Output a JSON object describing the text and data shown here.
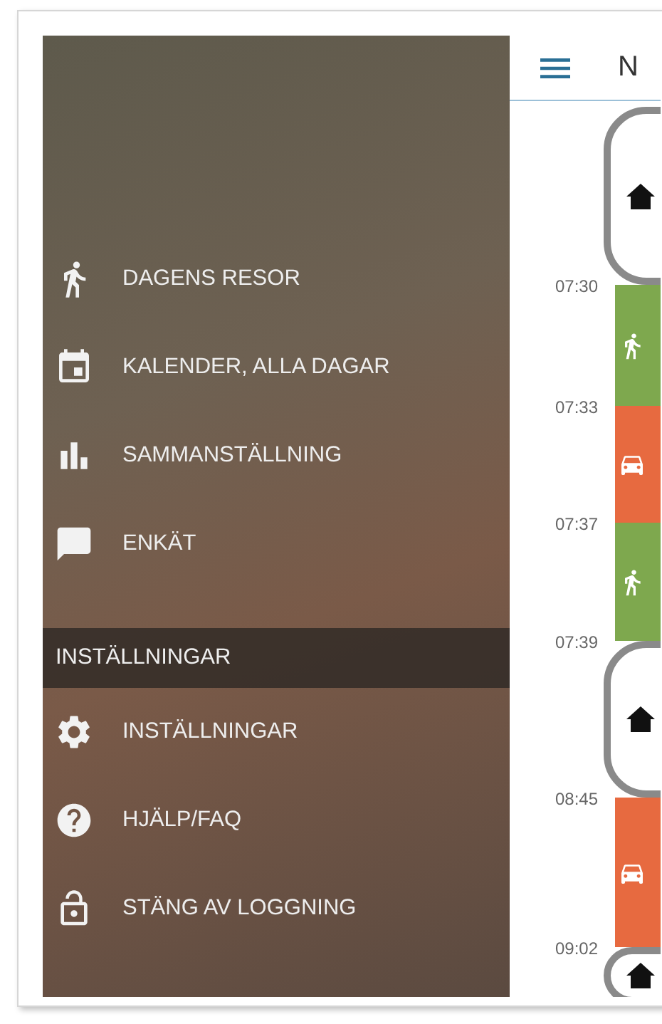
{
  "drawer": {
    "menu": [
      {
        "label": "DAGENS RESOR"
      },
      {
        "label": "KALENDER, ALLA DAGAR"
      },
      {
        "label": "SAMMANSTÄLLNING"
      },
      {
        "label": "ENKÄT"
      }
    ],
    "section_title": "INSTÄLLNINGAR",
    "settings_menu": [
      {
        "label": "INSTÄLLNINGAR"
      },
      {
        "label": "HJÄLP/FAQ"
      },
      {
        "label": "STÄNG AV LOGGNING"
      }
    ]
  },
  "header": {
    "title": "N"
  },
  "timeline": [
    {
      "kind": "place"
    },
    {
      "kind": "walk",
      "time": "07:30"
    },
    {
      "kind": "car",
      "time": "07:33"
    },
    {
      "kind": "walk",
      "time": "07:37"
    },
    {
      "kind": "place",
      "time": "07:39"
    },
    {
      "kind": "car",
      "time": "08:45"
    },
    {
      "kind": "place",
      "time": "09:02"
    }
  ]
}
